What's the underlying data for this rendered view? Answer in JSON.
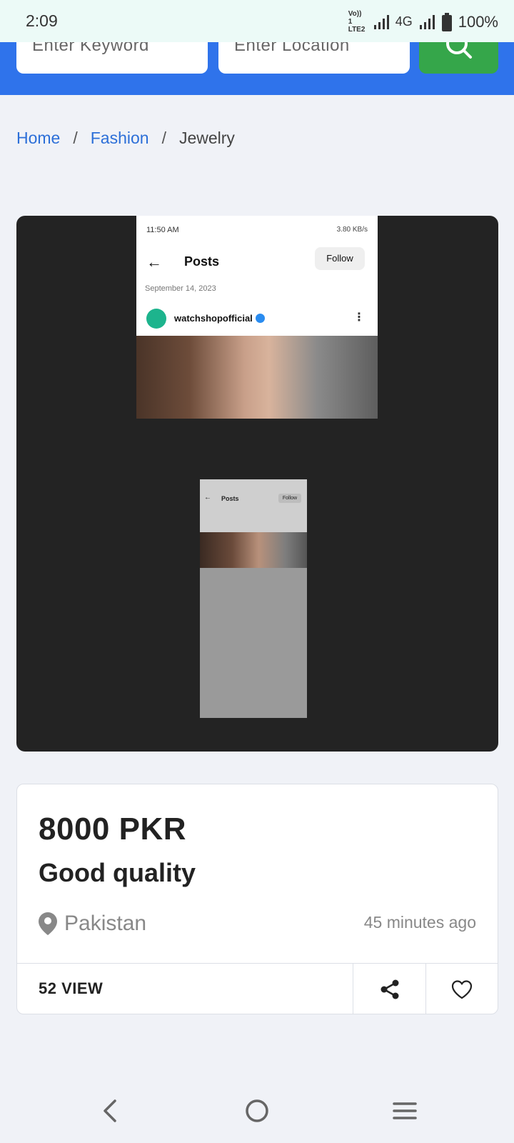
{
  "status_bar": {
    "time": "2:09",
    "network": "4G",
    "volte": "Vo)) 1 LTE2",
    "battery": "100%"
  },
  "search": {
    "keyword_placeholder": "Enter Keyword",
    "location_placeholder": "Enter Location",
    "button_icon": "search-icon"
  },
  "breadcrumb": {
    "items": [
      "Home",
      "Fashion"
    ],
    "current": "Jewelry",
    "separator": "/"
  },
  "media": {
    "main_screenshot": {
      "time": "11:50 AM",
      "status_right": "3.80 KB/s",
      "title": "Posts",
      "follow": "Follow",
      "date": "September 14, 2023",
      "username": "watchshopofficial"
    },
    "thumbnail": {
      "title": "Posts",
      "follow": "Follow"
    }
  },
  "listing": {
    "price": "8000 PKR",
    "title": "Good quality",
    "location": "Pakistan",
    "posted": "45 minutes ago",
    "views": "52 VIEW"
  },
  "colors": {
    "brand_blue": "#2f73eb",
    "search_green": "#35a64a",
    "link_blue": "#2c6fd8"
  }
}
